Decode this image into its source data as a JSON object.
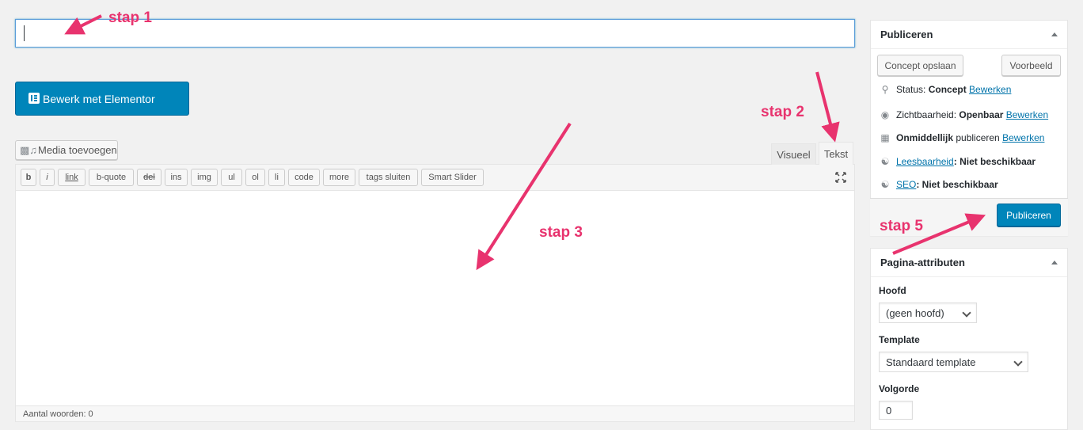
{
  "title": {
    "placeholder": ""
  },
  "elementor": {
    "label": "Bewerk met Elementor"
  },
  "media": {
    "label": "Media toevoegen"
  },
  "editor": {
    "tabs": [
      "Visueel",
      "Tekst"
    ],
    "quicktags": [
      "b",
      "i",
      "link",
      "b-quote",
      "del",
      "ins",
      "img",
      "ul",
      "ol",
      "li",
      "code",
      "more",
      "tags sluiten",
      "Smart Slider"
    ],
    "word_count": "Aantal woorden: 0"
  },
  "publish_box": {
    "title": "Publiceren",
    "save_draft": "Concept opslaan",
    "preview": "Voorbeeld",
    "status_label": "Status:",
    "status_value": "Concept",
    "visibility_label": "Zichtbaarheid:",
    "visibility_value": "Openbaar",
    "schedule_bold": "Onmiddellijk",
    "schedule_text": "publiceren",
    "edit": "Bewerken",
    "readability_link": "Leesbaarheid",
    "readability_value": ": Niet beschikbaar",
    "seo_link": "SEO",
    "seo_value": ": Niet beschikbaar",
    "publish": "Publiceren"
  },
  "page_attributes": {
    "title": "Pagina-attributen",
    "parent_label": "Hoofd",
    "parent_value": "(geen hoofd)",
    "template_label": "Template",
    "template_value": "Standaard template",
    "order_label": "Volgorde",
    "order_value": "0"
  },
  "annotations": [
    "stap 1",
    "stap 2",
    "stap 3",
    "stap 5"
  ],
  "colors": {
    "primary": "#0085ba",
    "annotation": "#e8336e",
    "link": "#0073aa"
  }
}
